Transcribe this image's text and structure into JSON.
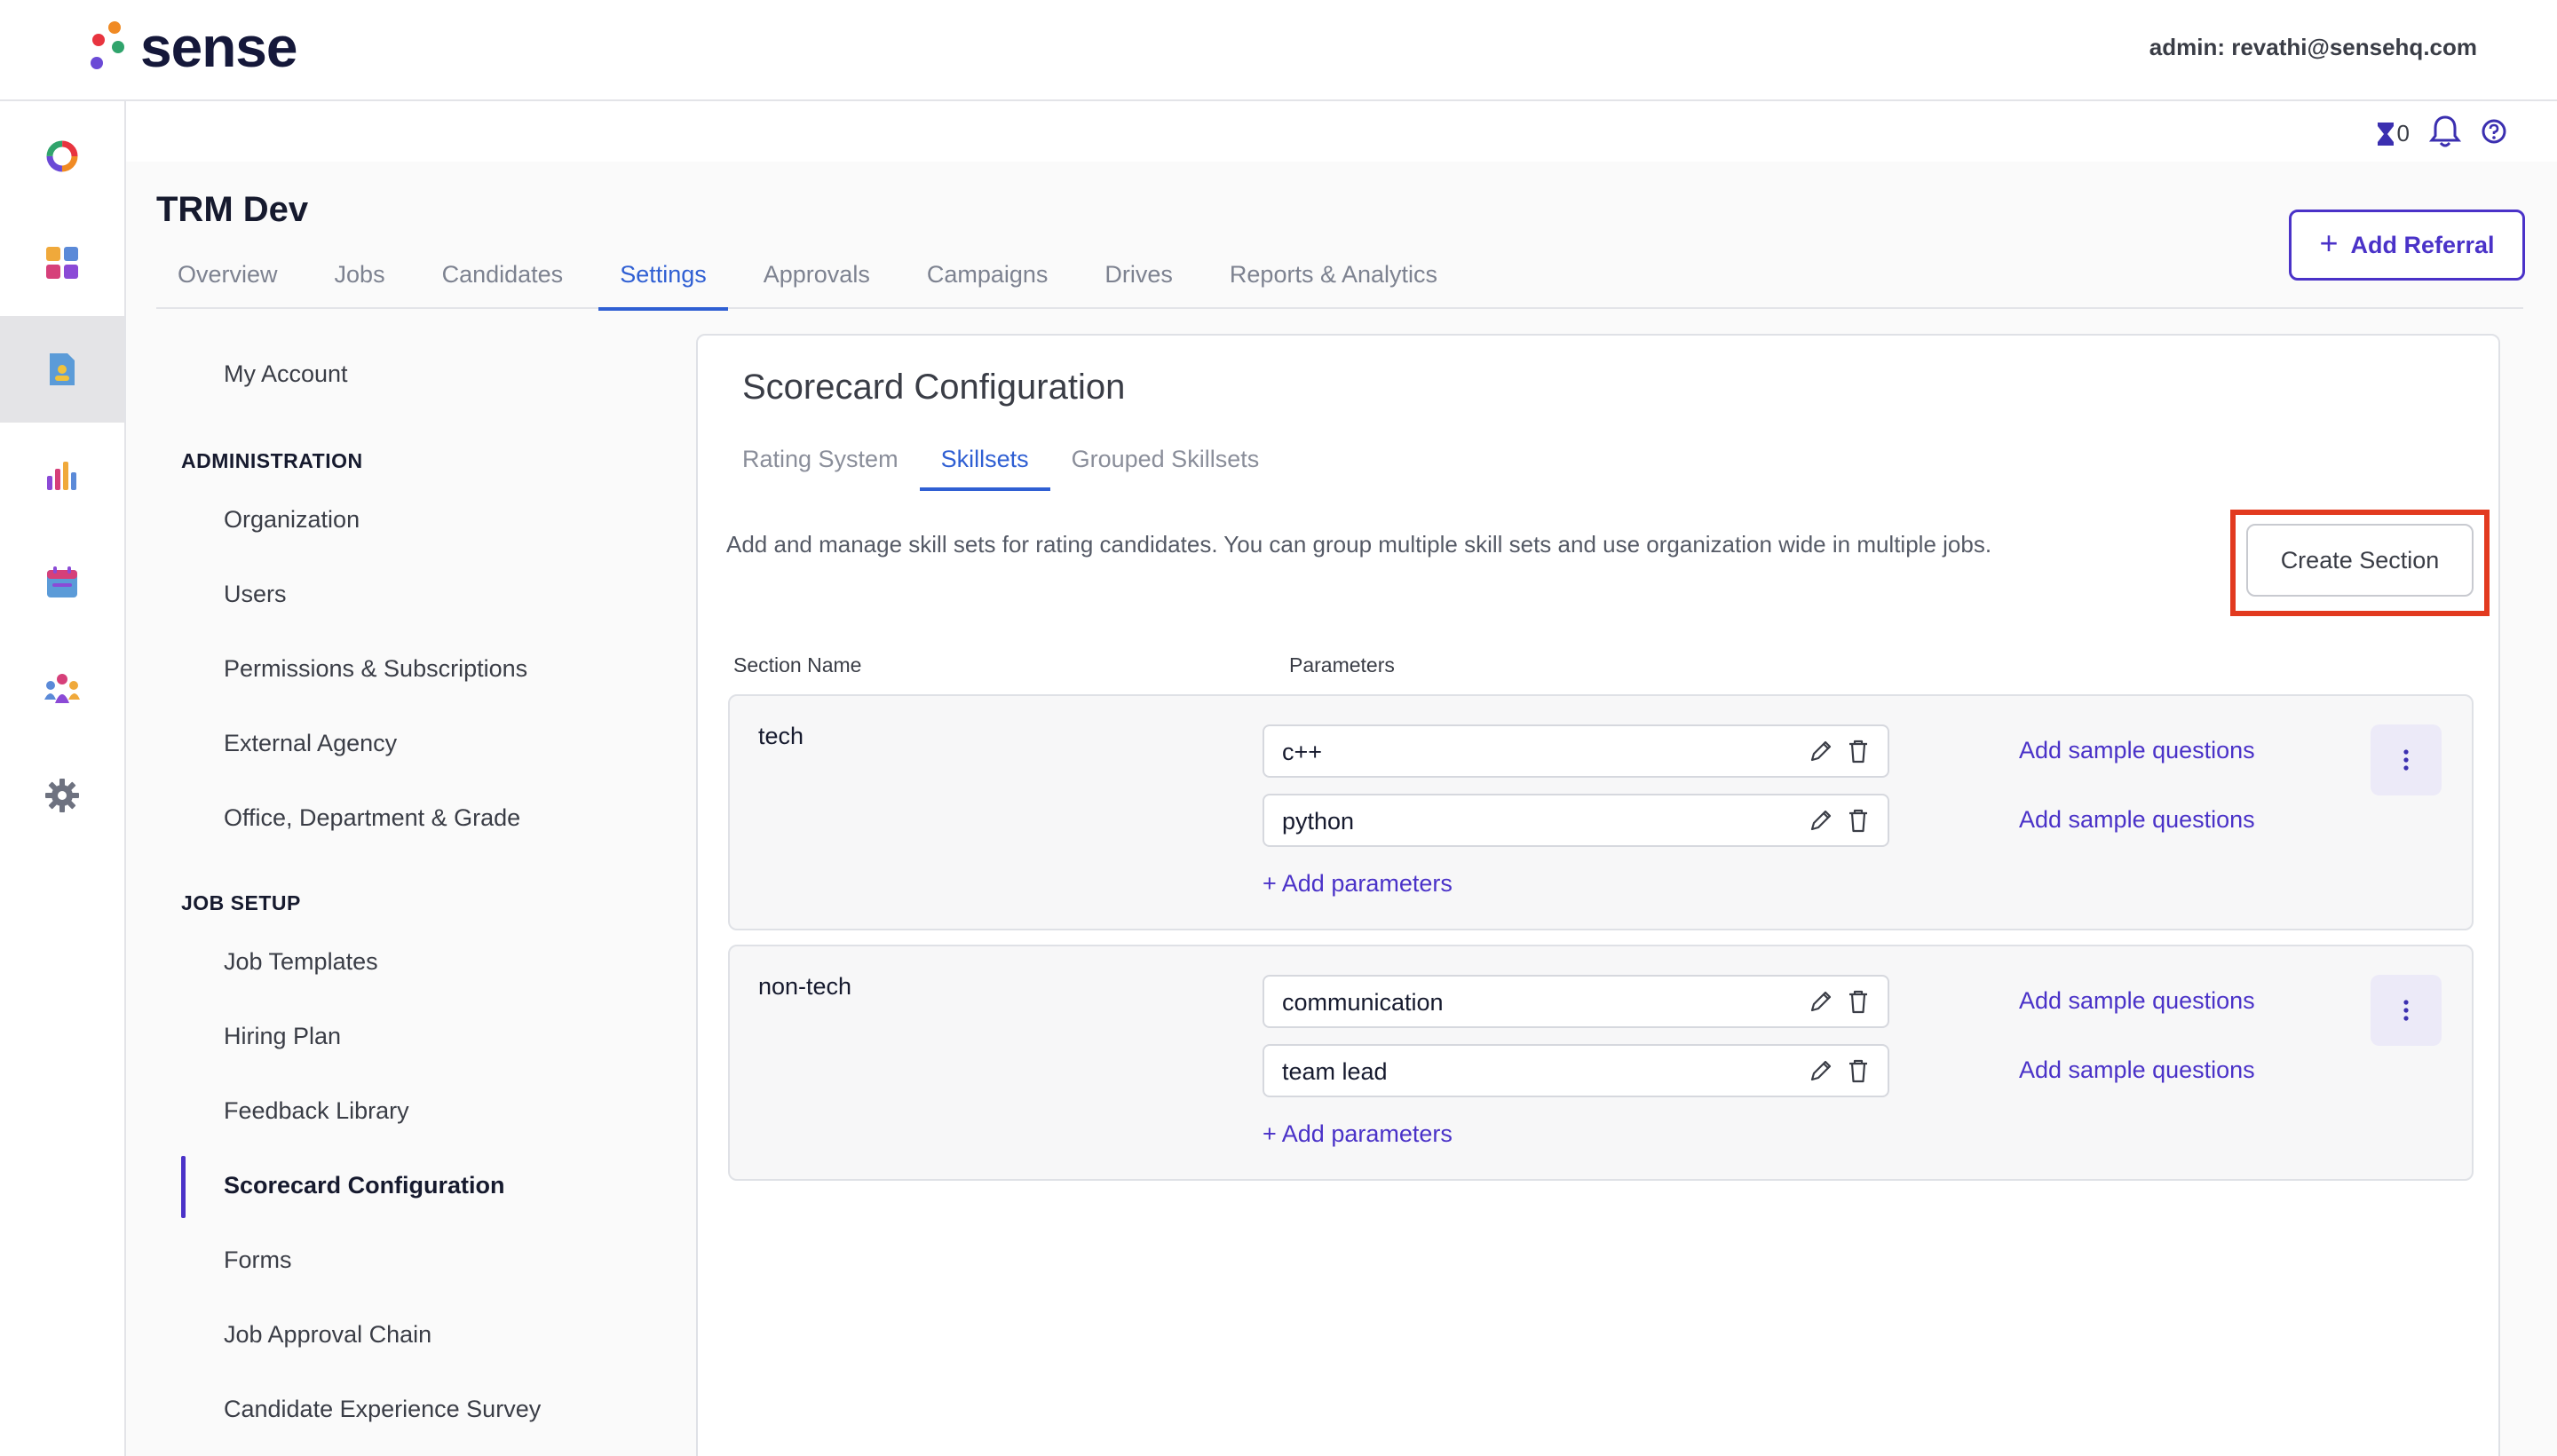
{
  "brand": {
    "name": "sense"
  },
  "header": {
    "admin_label": "admin: revathi@sensehq.com"
  },
  "utility": {
    "timer_count": "0"
  },
  "org": {
    "title": "TRM Dev"
  },
  "main_tabs": [
    "Overview",
    "Jobs",
    "Candidates",
    "Settings",
    "Approvals",
    "Campaigns",
    "Drives",
    "Reports & Analytics"
  ],
  "active_main_tab": "Settings",
  "add_referral_label": "Add Referral",
  "settings_nav": {
    "my_account": "My Account",
    "administration_heading": "ADMINISTRATION",
    "administration": [
      "Organization",
      "Users",
      "Permissions & Subscriptions",
      "External Agency",
      "Office, Department & Grade"
    ],
    "job_setup_heading": "JOB SETUP",
    "job_setup": [
      "Job Templates",
      "Hiring Plan",
      "Feedback Library",
      "Scorecard Configuration",
      "Forms",
      "Job Approval Chain",
      "Candidate Experience Survey"
    ],
    "active_item": "Scorecard Configuration"
  },
  "panel": {
    "title": "Scorecard Configuration",
    "sub_tabs": [
      "Rating System",
      "Skillsets",
      "Grouped Skillsets"
    ],
    "active_sub_tab": "Skillsets",
    "description": "Add and manage skill sets for rating candidates. You can group multiple skill sets and use organization wide in multiple jobs.",
    "create_section_label": "Create Section",
    "col_section_name": "Section Name",
    "col_parameters": "Parameters",
    "add_sample_label": "Add sample questions",
    "add_params_label": "+ Add parameters",
    "sections": [
      {
        "name": "tech",
        "parameters": [
          "c++",
          "python"
        ]
      },
      {
        "name": "non-tech",
        "parameters": [
          "communication",
          "team lead"
        ]
      }
    ]
  },
  "colors": {
    "accent": "#4a32c8",
    "tab_active": "#2f5fd3",
    "highlight": "#e23a1f"
  }
}
